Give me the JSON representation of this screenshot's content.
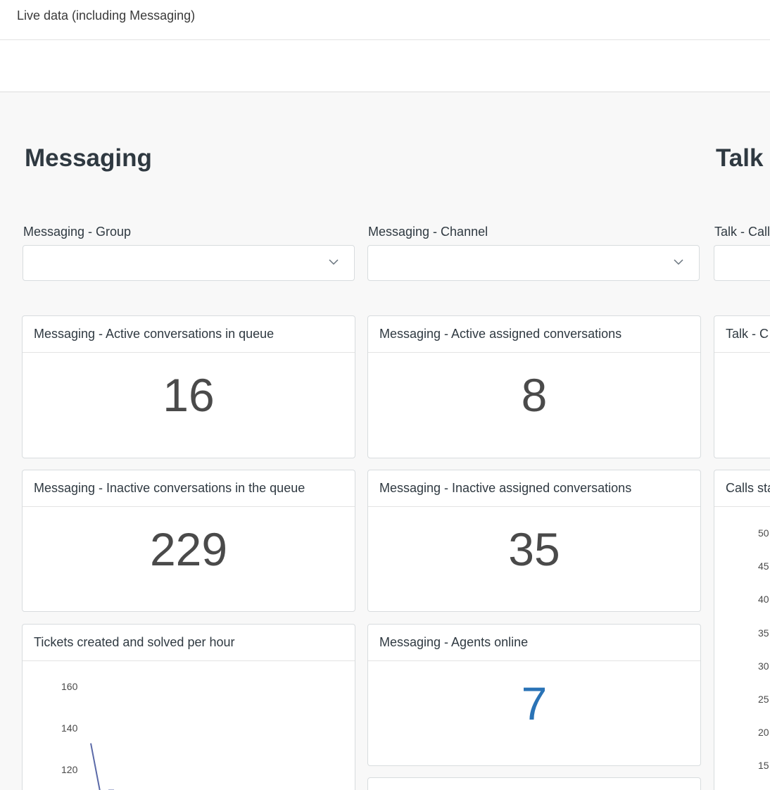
{
  "header": {
    "title": "Live data (including Messaging)"
  },
  "sections": {
    "messaging": "Messaging",
    "talk": "Talk"
  },
  "filters": {
    "messaging_group": {
      "label": "Messaging - Group",
      "value": ""
    },
    "messaging_channel": {
      "label": "Messaging - Channel",
      "value": ""
    },
    "talk_call": {
      "label": "Talk - Call",
      "value": ""
    }
  },
  "cards": {
    "active_in_queue": {
      "title": "Messaging - Active conversations in queue",
      "value": "16"
    },
    "active_assigned": {
      "title": "Messaging - Active assigned conversations",
      "value": "8"
    },
    "talk_c": {
      "title": "Talk - C"
    },
    "inactive_in_queue": {
      "title": "Messaging - Inactive conversations in the queue",
      "value": "229"
    },
    "inactive_assigned": {
      "title": "Messaging - Inactive assigned conversations",
      "value": "35"
    },
    "calls_stats": {
      "title": "Calls sta"
    },
    "tickets_per_hour": {
      "title": "Tickets created and solved per hour"
    },
    "agents_online": {
      "title": "Messaging - Agents online",
      "value": "7"
    }
  },
  "colors": {
    "accent_blue": "#2a73b6",
    "line_series": "#5b6aa8"
  },
  "chart_data": [
    {
      "type": "line",
      "title": "Tickets created and solved per hour",
      "yticks": [
        160,
        140,
        120
      ],
      "series": [
        {
          "values": [
            133,
            110
          ]
        }
      ]
    },
    {
      "type": "line",
      "title": "Calls sta",
      "yticks": [
        "50",
        "45",
        "40",
        "35",
        "30",
        "25",
        "20",
        "15"
      ]
    }
  ]
}
